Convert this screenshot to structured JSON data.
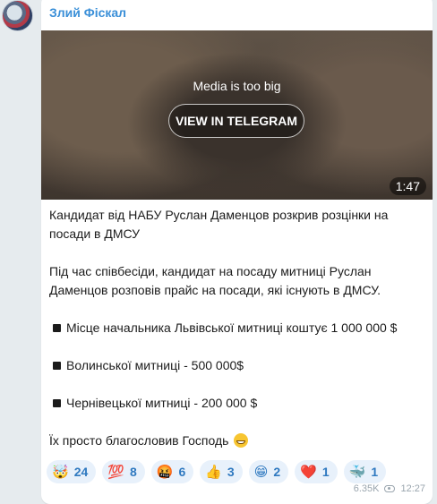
{
  "post": {
    "author": "Злий Фіскал",
    "media": {
      "notice": "Media is too big",
      "button_label": "VIEW IN TELEGRAM",
      "duration": "1:47"
    },
    "text": {
      "line1": "Кандидат від НАБУ Руслан Даменцов розкрив розцінки на",
      "line2": "посади в ДМСУ",
      "line3": "Під час співбесіди, кандидат на посаду митниці Руслан",
      "line4": "Даменцов розповів прайс на посади, які існують в ДМСУ.",
      "item1": "Місце начальника Львівської митниці коштує 1 000 000 $",
      "item2": "Волинської митниці - 500 000$",
      "item3": "Чернівецької митниці - 200 000 $",
      "closing": "Їх просто благословив Господь"
    },
    "reactions": [
      {
        "icon": "🤯",
        "count": "24",
        "name": "exploding-head"
      },
      {
        "icon": "💯",
        "count": "8",
        "name": "hundred-points"
      },
      {
        "icon": "🤬",
        "count": "6",
        "name": "swearing-face"
      },
      {
        "icon": "👍",
        "count": "3",
        "name": "thumbs-up"
      },
      {
        "icon": "😁",
        "count": "2",
        "name": "grinning-face"
      },
      {
        "icon": "❤️",
        "count": "1",
        "name": "red-heart"
      },
      {
        "icon": "🐳",
        "count": "1",
        "name": "whale"
      }
    ],
    "views": "6.35K",
    "time": "12:27"
  }
}
